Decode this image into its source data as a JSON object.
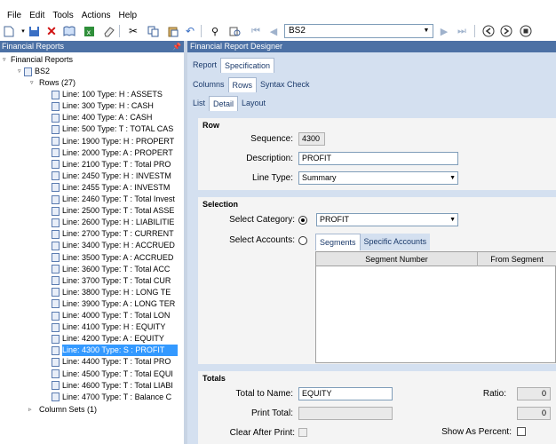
{
  "menu": [
    "File",
    "Edit",
    "Tools",
    "Actions",
    "Help"
  ],
  "toolbar": {
    "report_combo": "BS2"
  },
  "left_panel": {
    "title": "Financial Reports",
    "tree": {
      "root": "Financial Reports",
      "report": "BS2",
      "rows_label": "Rows (27)",
      "lines": [
        "Line: 100 Type: H : ASSETS",
        "Line: 300 Type: H : CASH",
        "Line: 400 Type: A : CASH",
        "Line: 500 Type: T : TOTAL CAS",
        "Line: 1900 Type: H : PROPERT",
        "Line: 2000 Type: A : PROPERT",
        "Line: 2100 Type: T : Total PRO",
        "Line: 2450 Type: H : INVESTM",
        "Line: 2455 Type: A : INVESTM",
        "Line: 2460 Type: T : Total Invest",
        "Line: 2500 Type: T : Total ASSE",
        "Line: 2600 Type: H : LIABILITIE",
        "Line: 2700 Type: T : CURRENT",
        "Line: 3400 Type: H : ACCRUED",
        "Line: 3500 Type: A : ACCRUED",
        "Line: 3600 Type: T : Total ACC",
        "Line: 3700 Type: T : Total CUR",
        "Line: 3800 Type: H : LONG TE",
        "Line: 3900 Type: A : LONG TER",
        "Line: 4000 Type: T : Total LON",
        "Line: 4100 Type: H : EQUITY",
        "Line: 4200 Type: A : EQUITY",
        "Line: 4300 Type: S : PROFIT",
        "Line: 4400 Type: T : Total PRO",
        "Line: 4500 Type: T : Total EQUI",
        "Line: 4600 Type: T : Total LIABI",
        "Line: 4700 Type: T : Balance C"
      ],
      "selected_index": 22,
      "column_sets_label": "Column Sets (1)"
    }
  },
  "designer": {
    "title": "Financial Report Designer",
    "tabs_level1": [
      "Report",
      "Specification"
    ],
    "tabs_level2": [
      "Columns",
      "Rows",
      "Syntax Check"
    ],
    "tabs_level3": [
      "List",
      "Detail",
      "Layout"
    ],
    "row_section": {
      "title": "Row",
      "sequence_label": "Sequence:",
      "sequence_value": "4300",
      "description_label": "Description:",
      "description_value": "PROFIT",
      "line_type_label": "Line Type:",
      "line_type_value": "Summary"
    },
    "selection_section": {
      "title": "Selection",
      "select_category_label": "Select Category:",
      "category_value": "PROFIT",
      "select_accounts_label": "Select Accounts:",
      "subtabs": [
        "Segments",
        "Specific Accounts"
      ],
      "grid_columns": [
        "Segment Number",
        "From Segment"
      ]
    },
    "totals_section": {
      "title": "Totals",
      "total_to_name_label": "Total to Name:",
      "total_to_name_value": "EQUITY",
      "ratio_label": "Ratio:",
      "ratio_value": "0",
      "print_total_label": "Print Total:",
      "print_total_value": "",
      "print_total_number": "0",
      "clear_after_print_label": "Clear After Print:",
      "show_as_percent_label": "Show As Percent:"
    }
  },
  "colors": {
    "header_bg": "#4c71a5",
    "panel_bg": "#d4e0f0",
    "selected": "#3399ff"
  }
}
